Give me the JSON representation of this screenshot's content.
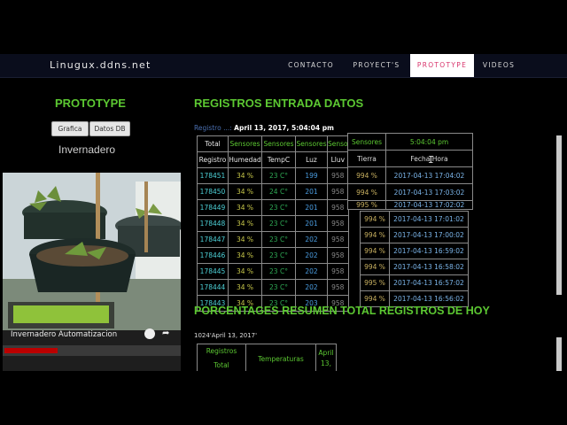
{
  "navbar": {
    "brand": "Linugux.ddns.net",
    "items": [
      "CONTACTO",
      "PROYECT'S",
      "PROTOTYPE",
      "VIDEOS"
    ]
  },
  "left": {
    "heading": "PROTOTYPE",
    "buttons": [
      "Grafica",
      "Datos DB"
    ],
    "subtitle": "Invernadero",
    "video_title": "Invernadero Automatizacion"
  },
  "registros": {
    "heading": "REGISTROS ENTRADA DATOS",
    "caption_prefix": "Registro ...:",
    "caption_date": "April 13, 2017, 5:04:04 pm",
    "header1": [
      "Total",
      "Sensores",
      "Sensores",
      "Sensores",
      "Senso"
    ],
    "header2": [
      "Registro",
      "Humedad",
      "TempC",
      "Luz",
      "Lluv"
    ],
    "rows": [
      [
        "178451",
        "34 %",
        "23 C°",
        "199",
        "958"
      ],
      [
        "178450",
        "34 %",
        "24 C°",
        "201",
        "958"
      ],
      [
        "178449",
        "34 %",
        "23 C°",
        "201",
        "958"
      ],
      [
        "178448",
        "34 %",
        "23 C°",
        "201",
        "958"
      ],
      [
        "178447",
        "34 %",
        "23 C°",
        "202",
        "958"
      ],
      [
        "178446",
        "34 %",
        "23 C°",
        "202",
        "958"
      ],
      [
        "178445",
        "34 %",
        "23 C°",
        "202",
        "958"
      ],
      [
        "178444",
        "34 %",
        "23 C°",
        "202",
        "958"
      ],
      [
        "178443",
        "34 %",
        "23 C°",
        "203",
        "958"
      ]
    ],
    "right_rows": [
      [
        "994 %",
        "2017-04-13 17:01:02"
      ],
      [
        "994 %",
        "2017-04-13 17:00:02"
      ],
      [
        "994 %",
        "2017-04-13 16:59:02"
      ],
      [
        "994 %",
        "2017-04-13 16:58:02"
      ],
      [
        "995 %",
        "2017-04-13 16:57:02"
      ],
      [
        "994 %",
        "2017-04-13 16:56:02"
      ]
    ]
  },
  "overlay": {
    "h1": [
      "Sensores",
      "5:04:04 pm"
    ],
    "h2": [
      "Tierra",
      "Fecha Hora"
    ],
    "rows": [
      [
        "994 %",
        "2017-04-13 17:04:02"
      ],
      [
        "994 %",
        "2017-04-13 17:03:02"
      ],
      [
        "995 %",
        "2017-04-13 17:02:02"
      ]
    ]
  },
  "resumen": {
    "heading": "PORCENTAGES RESUMEN TOTAL REGISTROS DE HOY",
    "caption": "1024'April 13, 2017'",
    "col1a": "Registros",
    "col1b": "Total",
    "col2": "Temperaturas",
    "col3a": "April",
    "col3b": "13,"
  },
  "colors": {
    "accent_green": "#5cc832",
    "active_nav_text": "#d8336b"
  }
}
